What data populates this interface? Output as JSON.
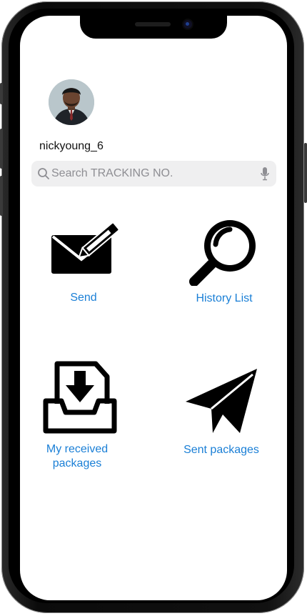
{
  "profile": {
    "username": "nickyoung_6",
    "avatar_icon": "user-avatar-photo"
  },
  "search": {
    "placeholder": "Search TRACKING NO.",
    "value": "",
    "search_icon": "search-icon",
    "mic_icon": "mic-icon"
  },
  "menu": {
    "send": {
      "label": "Send",
      "icon": "envelope-pencil-icon"
    },
    "history": {
      "label": "History List",
      "icon": "magnifier-icon"
    },
    "received_line1": "My received",
    "received_line2": "packages",
    "received_icon": "inbox-download-icon",
    "sent": {
      "label": "Sent packages",
      "icon": "paper-plane-icon"
    }
  },
  "colors": {
    "accent": "#1a7fd6",
    "icon": "#000000",
    "search_bg": "#efeff0"
  }
}
